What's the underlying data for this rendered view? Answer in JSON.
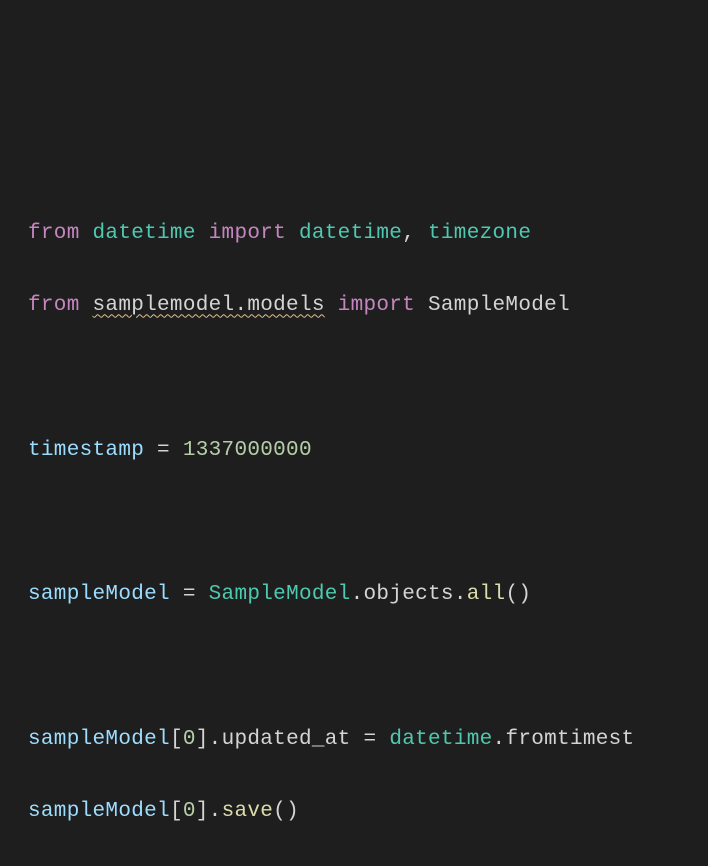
{
  "code": {
    "line1": {
      "from": "from",
      "module1": "datetime",
      "import": "import",
      "name1": "datetime",
      "comma": ",",
      "name2": "timezone"
    },
    "line2": {
      "from": "from",
      "module": "samplemodel.models",
      "import": "import",
      "name": "SampleModel"
    },
    "line3": {
      "var": "timestamp",
      "eq": " = ",
      "value": "1337000000"
    },
    "line4": {
      "var": "sampleModel",
      "eq": " = ",
      "class": "SampleModel",
      "dot1": ".",
      "prop": "objects",
      "dot2": ".",
      "method": "all",
      "parens": "()"
    },
    "line5": {
      "var": "sampleModel",
      "lbracket": "[",
      "index": "0",
      "rbracket": "]",
      "dot1": ".",
      "prop": "updated_at",
      "eq": " = ",
      "class": "datetime",
      "dot2": ".",
      "method": "fromtimest"
    },
    "line6": {
      "var": "sampleModel",
      "lbracket": "[",
      "index": "0",
      "rbracket": "]",
      "dot": ".",
      "method": "save",
      "parens": "()"
    }
  }
}
